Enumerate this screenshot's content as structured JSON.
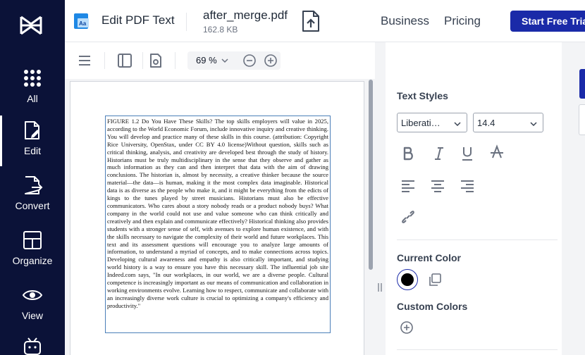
{
  "nav": {
    "items": [
      {
        "label": "All",
        "icon": "grid-icon"
      },
      {
        "label": "Edit",
        "icon": "edit-document-icon"
      },
      {
        "label": "Convert",
        "icon": "convert-icon"
      },
      {
        "label": "Organize",
        "icon": "organize-icon"
      },
      {
        "label": "View",
        "icon": "eye-icon"
      }
    ]
  },
  "header": {
    "tool_name": "Edit PDF Text",
    "file_name": "after_merge.pdf",
    "file_size": "162.8 KB",
    "links": [
      "Business",
      "Pricing"
    ],
    "cta": "Start Free Tria"
  },
  "toolbar": {
    "zoom": "69 %"
  },
  "document": {
    "text": "FIGURE 1.2 Do You Have These Skills? The top skills employers will value in 2025, according to the World Economic Forum, include innovative inquiry and creative thinking. You will develop and practice many of these skills in this course. (attribution: Copyright Rice University, OpenStax, under CC BY 4.0 license)Without question, skills such as critical thinking, analysis, and creativity are developed best through the study of history. Historians must be truly multidisciplinary in the sense that they observe and gather as much information as they can and then interpret that data with the aim of drawing conclusions. The historian is, almost by necessity, a creative thinker because the source material—the data—is human, making it the most complex data imaginable. Historical data is as diverse as the people who make it, and it might be everything from the edicts of kings to the tunes played by street musicians. Historians must also be effective communicators. Who cares about a story nobody reads or a product nobody buys? What company in the world could not use and value someone who can think critically and creatively and then explain and communicate effectively? Historical thinking also provides students with a stronger sense of self, with avenues to explore human existence, and with the skills necessary to navigate the complexity of their world and future workplaces. This text and its assessment questions will encourage you to analyze large amounts of information, to understand a myriad of concepts, and to make connections across topics. Developing cultural awareness and empathy is also critically important, and studying world history is a way to ensure you have this necessary skill. The influential job site Indeed.com says, \"In our workplaces, in our world, we are a diverse people. Cultural competence is increasingly important as our means of communication and collaboration in working environments evolve. Learning how to respect, communicate and collaborate with an increasingly diverse work culture is crucial to optimizing a company's efficiency and productivity.\""
  },
  "panel": {
    "text_styles_title": "Text Styles",
    "font_family": "Liberati…",
    "font_size": "14.4",
    "current_color_title": "Current Color",
    "current_color": "#000000",
    "custom_colors_title": "Custom Colors"
  },
  "colors": {
    "nav_bg": "#0b1238",
    "accent": "#1a2aa8"
  }
}
